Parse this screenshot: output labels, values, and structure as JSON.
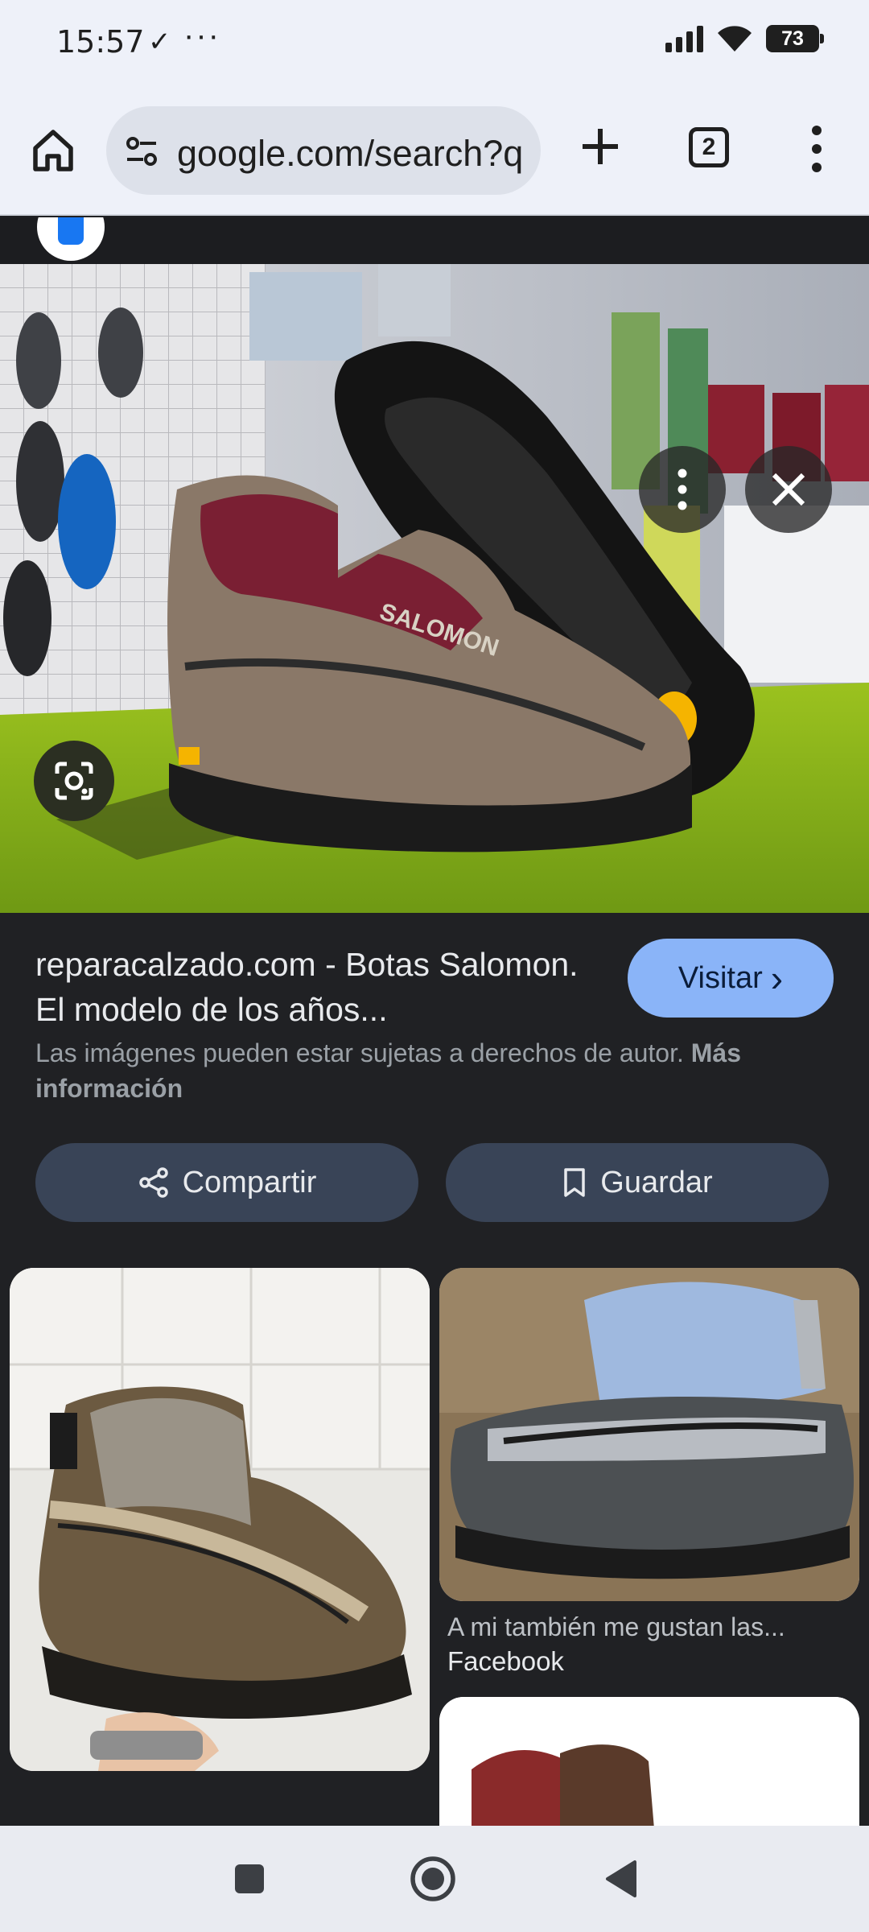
{
  "status_bar": {
    "time": "15:57",
    "check_glyph": "✓",
    "dots": "···",
    "battery": "73"
  },
  "toolbar": {
    "url": "google.com/search?q",
    "tab_count": "2",
    "icons": [
      "home-icon",
      "site-settings-icon",
      "plus-icon",
      "tab-switcher-icon",
      "more-vert-icon"
    ]
  },
  "viewer": {
    "result_title": "reparacalzado.com - Botas Salomon. El modelo de los años...",
    "visit_label": "Visitar",
    "visit_chevron": "›",
    "copyright_text": "Las imágenes pueden estar sujetas a derechos de autor.",
    "copyright_link": "Más información",
    "share_label": "Compartir",
    "save_label": "Guardar",
    "boot_brand": "SALOMON"
  },
  "related": [
    {
      "caption": "A mi también me gustan las...",
      "source": "Facebook"
    }
  ],
  "colors": {
    "chrome_bg": "#eef1f9",
    "page_bg": "#202124",
    "accent": "#8ab4f8",
    "chip_bg": "#394457"
  }
}
